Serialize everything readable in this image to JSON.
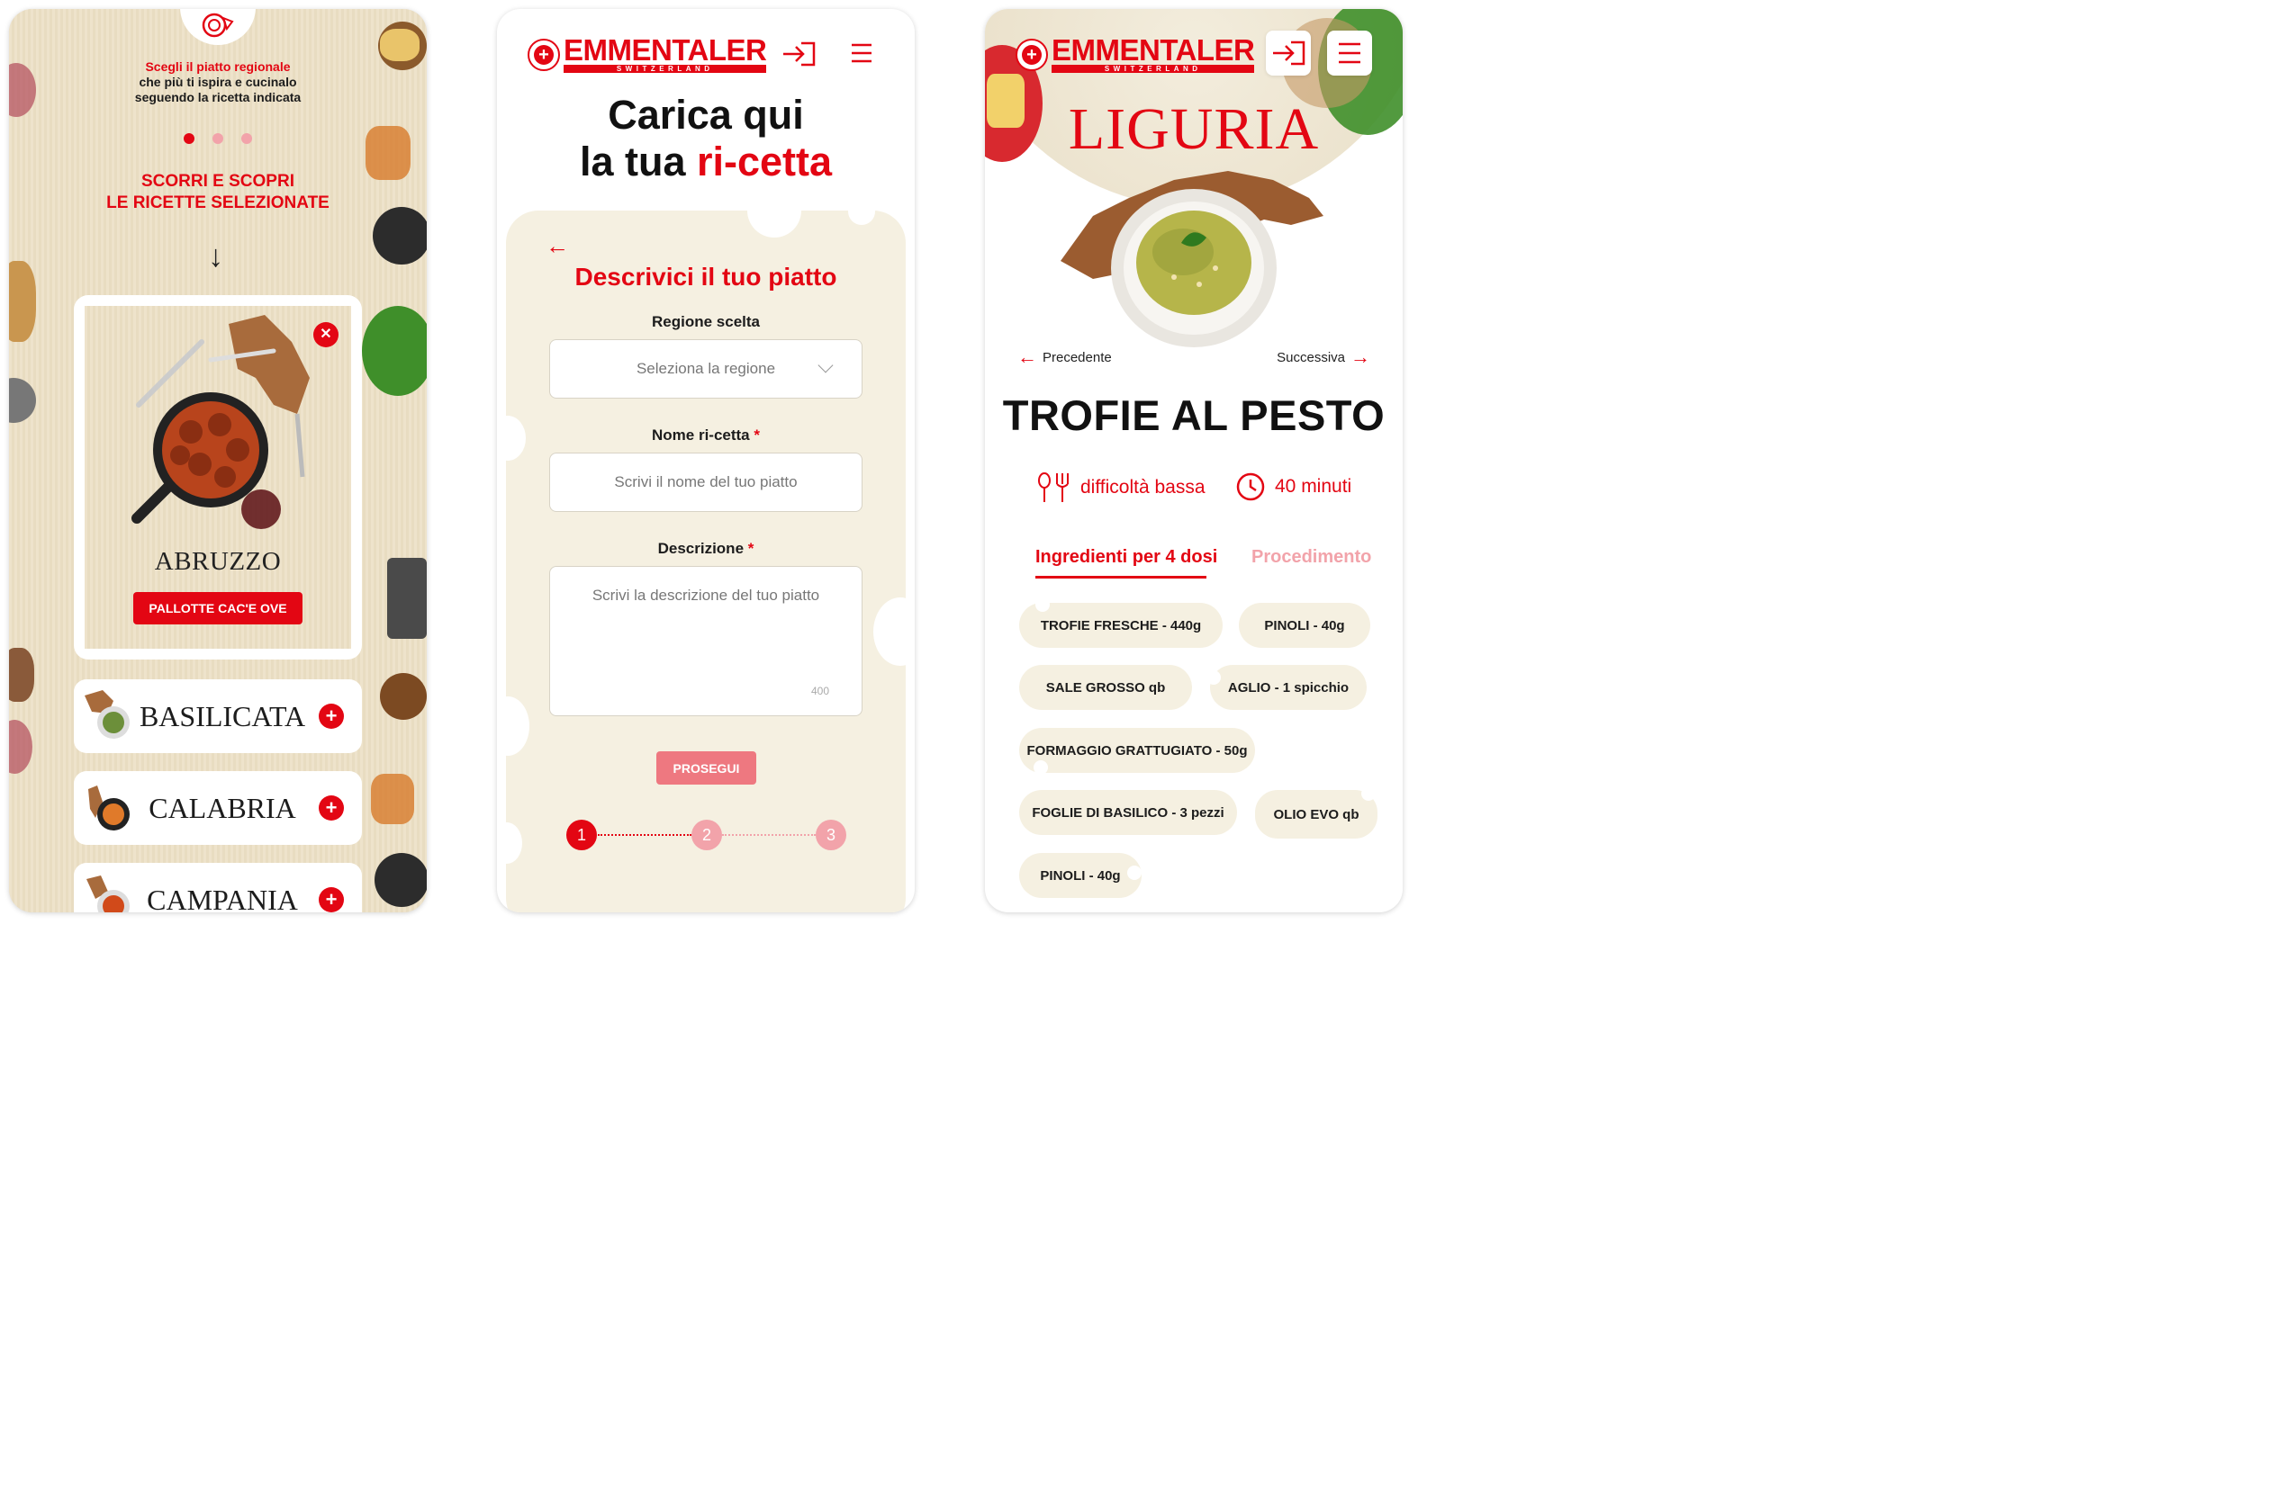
{
  "brand": {
    "name": "EMMENTALER",
    "sub": "SWITZERLAND"
  },
  "screen1": {
    "intro_line1": "Scegli il piatto regionale",
    "intro_line2": "che più ti ispira e cucinalo",
    "intro_line3": "seguendo la ricetta indicata",
    "scroll_line1": "SCORRI E SCOPRI",
    "scroll_line2": "LE RICETTE SELEZIONATE",
    "arrow": "↓",
    "selected_region": "ABRUZZO",
    "selected_recipe": "PALLOTTE CAC'E OVE",
    "regions": [
      "BASILICATA",
      "CALABRIA",
      "CAMPANIA"
    ]
  },
  "screen2": {
    "title_line1": "Carica qui",
    "title_line2_a": "la tua ",
    "title_line2_b": "ri-cetta",
    "back": "←",
    "subtitle": "Descrivici il tuo piatto",
    "region_label": "Regione scelta",
    "region_placeholder": "Seleziona la regione",
    "name_label": "Nome ri-cetta",
    "name_placeholder": "Scrivi il nome del tuo piatto",
    "desc_label": "Descrizione",
    "desc_placeholder": "Scrivi la descrizione del tuo piatto",
    "required_mark": "*",
    "char_counter": "400",
    "submit": "PROSEGUI",
    "steps": [
      "1",
      "2",
      "3"
    ],
    "current_step": 1
  },
  "screen3": {
    "region": "LIGURIA",
    "prev": "Precedente",
    "next": "Successiva",
    "recipe_title": "TROFIE AL PESTO",
    "difficulty": "difficoltà bassa",
    "time": "40 minuti",
    "tab_ingredients": "Ingredienti per 4 dosi",
    "tab_procedure": "Procedimento",
    "ingredients": [
      "TROFIE FRESCHE - 440g",
      "PINOLI - 40g",
      "SALE GROSSO qb",
      "AGLIO - 1 spicchio",
      "FORMAGGIO GRATTUGIATO - 50g",
      "FOGLIE DI BASILICO - 3 pezzi",
      "OLIO EVO qb",
      "PINOLI - 40g"
    ]
  },
  "colors": {
    "accent": "#e30613",
    "accent_light": "#ee7880",
    "cream": "#f5f0e1"
  }
}
